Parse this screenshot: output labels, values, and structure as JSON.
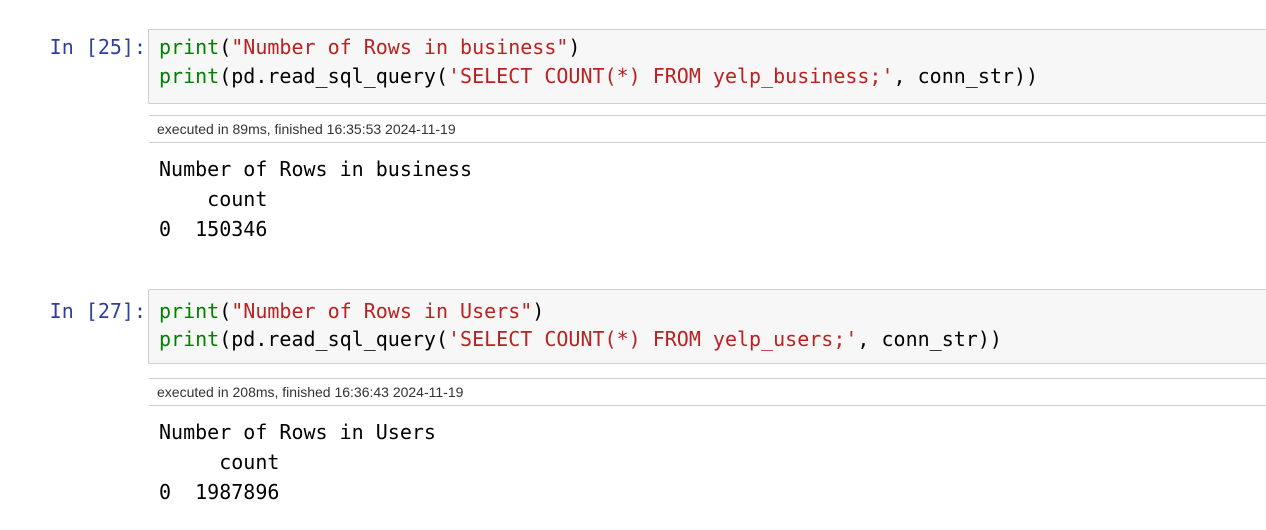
{
  "cells": [
    {
      "prompt": "In [25]:",
      "code": {
        "line1": {
          "fn": "print",
          "open": "(",
          "str": "\"Number of Rows in business\"",
          "close": ")"
        },
        "line2": {
          "fn": "print",
          "mid": "(pd.read_sql_query(",
          "str": "'SELECT COUNT(*) FROM yelp_business;'",
          "tail": ", conn_str))"
        }
      },
      "exec_info": "executed in 89ms, finished 16:35:53 2024-11-19",
      "output": {
        "line1": "Number of Rows in business",
        "line2": "    count",
        "line3": "0  150346"
      }
    },
    {
      "prompt": "In [27]:",
      "code": {
        "line1": {
          "fn": "print",
          "open": "(",
          "str": "\"Number of Rows in Users\"",
          "close": ")"
        },
        "line2": {
          "fn": "print",
          "mid": "(pd.read_sql_query(",
          "str": "'SELECT COUNT(*) FROM yelp_users;'",
          "tail": ", conn_str))"
        }
      },
      "exec_info": "executed in 208ms, finished 16:36:43 2024-11-19",
      "output": {
        "line1": "Number of Rows in Users",
        "line2": "     count",
        "line3": "0  1987896"
      }
    }
  ]
}
